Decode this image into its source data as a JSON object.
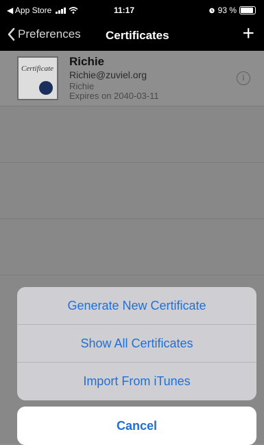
{
  "status_bar": {
    "back_app": "◀ App Store",
    "time": "11:17",
    "battery_percent": "93 %",
    "battery_level": 0.93,
    "icons": [
      "back-arrow-icon",
      "signal-bars-icon",
      "wifi-icon",
      "alarm-icon",
      "battery-icon"
    ]
  },
  "nav": {
    "back_label": "Preferences",
    "title": "Certificates",
    "add_icon": "+"
  },
  "certificates": [
    {
      "thumb_label": "Certificate",
      "name": "Richie",
      "email": "Richie@zuviel.org",
      "common_name": "Richie",
      "expires": "Expires on 2040-03-11",
      "info_icon": "i"
    }
  ],
  "action_sheet": {
    "actions": [
      "Generate New Certificate",
      "Show All Certificates",
      "Import From iTunes"
    ],
    "cancel": "Cancel"
  },
  "colors": {
    "accent": "#1f6fd6",
    "nav_background": "#000000",
    "dimmed_list": "#8e8e8e",
    "sheet_background": "#cfcfd3"
  }
}
